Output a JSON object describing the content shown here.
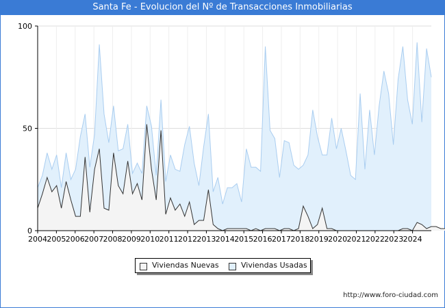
{
  "title": "Santa Fe - Evolucion del Nº de Transacciones Inmobiliarias",
  "footer": "http://www.foro-ciudad.com",
  "legend": {
    "nuevas": "Viviendas Nuevas",
    "usadas": "Viviendas Usadas"
  },
  "colors": {
    "title_bar": "#3a7bd5",
    "nuevas_fill": "#f4f4f4",
    "nuevas_line": "#333333",
    "usadas_fill": "#e1f0fc",
    "usadas_line": "#a9cdf0",
    "grid": "#dddddd"
  },
  "chart_data": {
    "type": "area",
    "x_tick_labels": [
      "2004",
      "2005",
      "2006",
      "2007",
      "2008",
      "2009",
      "2010",
      "2011",
      "2012",
      "2013",
      "2014",
      "2015",
      "2016",
      "2017",
      "2018",
      "2019",
      "2020",
      "2021",
      "2022",
      "2023",
      "2024"
    ],
    "y_ticks": [
      0,
      50,
      100
    ],
    "ylim": [
      0,
      100
    ],
    "grid": true,
    "legend_position": "bottom-center",
    "series": [
      {
        "name": "Viviendas Nuevas",
        "values": [
          11,
          18,
          26,
          19,
          22,
          11,
          24,
          15,
          7,
          7,
          36,
          9,
          30,
          40,
          11,
          10,
          38,
          22,
          18,
          34,
          18,
          23,
          15,
          52,
          30,
          15,
          49,
          8,
          16,
          10,
          13,
          7,
          14,
          3,
          5,
          5,
          20,
          3,
          1,
          0,
          1,
          1,
          1,
          1,
          1,
          0,
          1,
          0,
          1,
          1,
          1,
          0,
          1,
          1,
          0,
          1,
          12,
          7,
          1,
          3,
          11,
          1,
          1,
          0,
          0,
          0,
          0,
          0,
          0,
          0,
          0,
          0,
          0,
          0,
          0,
          0,
          0,
          1,
          1,
          0,
          4,
          3,
          1,
          2,
          2,
          1,
          1,
          1
        ]
      },
      {
        "name": "Viviendas Usadas",
        "values": [
          21,
          27,
          38,
          30,
          37,
          21,
          38,
          25,
          30,
          46,
          57,
          31,
          47,
          91,
          57,
          43,
          61,
          39,
          40,
          52,
          28,
          33,
          28,
          61,
          51,
          27,
          64,
          24,
          37,
          30,
          29,
          42,
          51,
          33,
          22,
          41,
          57,
          19,
          26,
          13,
          21,
          21,
          23,
          14,
          40,
          31,
          31,
          29,
          90,
          49,
          45,
          26,
          44,
          43,
          32,
          30,
          32,
          37,
          59,
          46,
          37,
          37,
          55,
          40,
          50,
          39,
          27,
          25,
          67,
          30,
          59,
          37,
          61,
          78,
          67,
          42,
          74,
          90,
          64,
          52,
          92,
          53,
          89,
          75
        ]
      }
    ]
  }
}
